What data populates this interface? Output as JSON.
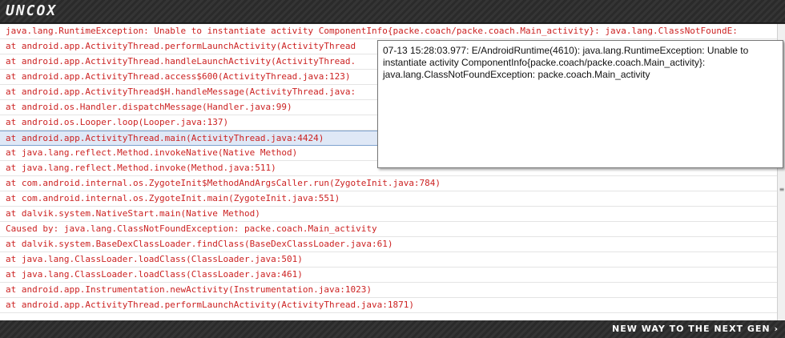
{
  "header": {
    "logo": "UNCOX"
  },
  "log": {
    "rows": [
      "java.lang.RuntimeException: Unable to instantiate activity ComponentInfo{packe.coach/packe.coach.Main_activity}: java.lang.ClassNotFoundE:",
      "at android.app.ActivityThread.performLaunchActivity(ActivityThread",
      "at android.app.ActivityThread.handleLaunchActivity(ActivityThread.",
      "at android.app.ActivityThread.access$600(ActivityThread.java:123)",
      "at android.app.ActivityThread$H.handleMessage(ActivityThread.java:",
      "at android.os.Handler.dispatchMessage(Handler.java:99)",
      "at android.os.Looper.loop(Looper.java:137)",
      "at android.app.ActivityThread.main(ActivityThread.java:4424)",
      "at java.lang.reflect.Method.invokeNative(Native Method)",
      "at java.lang.reflect.Method.invoke(Method.java:511)",
      "at com.android.internal.os.ZygoteInit$MethodAndArgsCaller.run(ZygoteInit.java:784)",
      "at com.android.internal.os.ZygoteInit.main(ZygoteInit.java:551)",
      "at dalvik.system.NativeStart.main(Native Method)",
      "Caused by: java.lang.ClassNotFoundException: packe.coach.Main_activity",
      "at dalvik.system.BaseDexClassLoader.findClass(BaseDexClassLoader.java:61)",
      "at java.lang.ClassLoader.loadClass(ClassLoader.java:501)",
      "at java.lang.ClassLoader.loadClass(ClassLoader.java:461)",
      "at android.app.Instrumentation.newActivity(Instrumentation.java:1023)",
      "at android.app.ActivityThread.performLaunchActivity(ActivityThread.java:1871)",
      "..."
    ]
  },
  "tooltip": {
    "text": "07-13 15:28:03.977: E/AndroidRuntime(4610): java.lang.RuntimeException: Unable to instantiate activity ComponentInfo{packe.coach/packe.coach.Main_activity}: java.lang.ClassNotFoundException: packe.coach.Main_activity"
  },
  "footer": {
    "slogan": "NEW WAY TO THE NEXT GEN ›"
  },
  "colors": {
    "error_text": "#cc2222",
    "selection": "#dfe8f6"
  }
}
